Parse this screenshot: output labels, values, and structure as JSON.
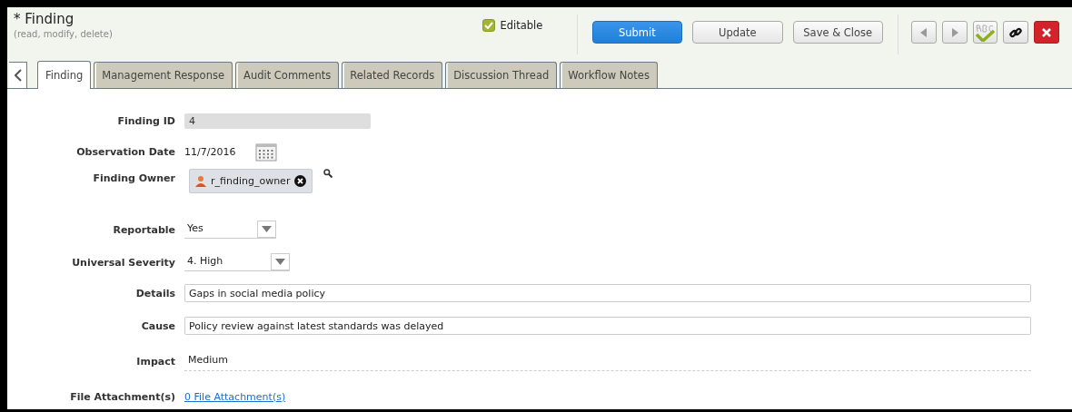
{
  "header": {
    "required_mark": "*",
    "title": "Finding",
    "subtitle": "(read, modify, delete)",
    "editable": {
      "label": "Editable",
      "checked": true
    }
  },
  "buttons": [
    {
      "label": "Submit",
      "kind": "primary"
    },
    {
      "label": "Update",
      "kind": "plain"
    },
    {
      "label": "Save & Close",
      "kind": "plain"
    }
  ],
  "tabs": [
    {
      "label": "Finding",
      "selected": true
    },
    {
      "label": "Management Response",
      "selected": false
    },
    {
      "label": "Audit Comments",
      "selected": false
    },
    {
      "label": "Related Records",
      "selected": false
    },
    {
      "label": "Discussion Thread",
      "selected": false
    },
    {
      "label": "Workflow Notes",
      "selected": false
    }
  ],
  "fields": [
    {
      "label": "Finding ID",
      "kind": "readonly",
      "value": "4"
    },
    {
      "label": "Observation Date",
      "kind": "date",
      "value": "11/7/2016"
    },
    {
      "label": "Finding Owner",
      "kind": "user",
      "value": "r_finding_owner"
    },
    {
      "label": "Reportable",
      "kind": "select",
      "value": "Yes"
    },
    {
      "label": "Universal Severity",
      "kind": "select",
      "value": "4. High"
    },
    {
      "label": "Details",
      "kind": "text",
      "value": "Gaps in social media policy"
    },
    {
      "label": "Cause",
      "kind": "text",
      "value": "Policy review against latest standards was delayed"
    },
    {
      "label": "Impact",
      "kind": "static",
      "value": "Medium"
    },
    {
      "label": "File Attachment(s)",
      "kind": "link",
      "value": "0 File Attachment(s)"
    }
  ]
}
